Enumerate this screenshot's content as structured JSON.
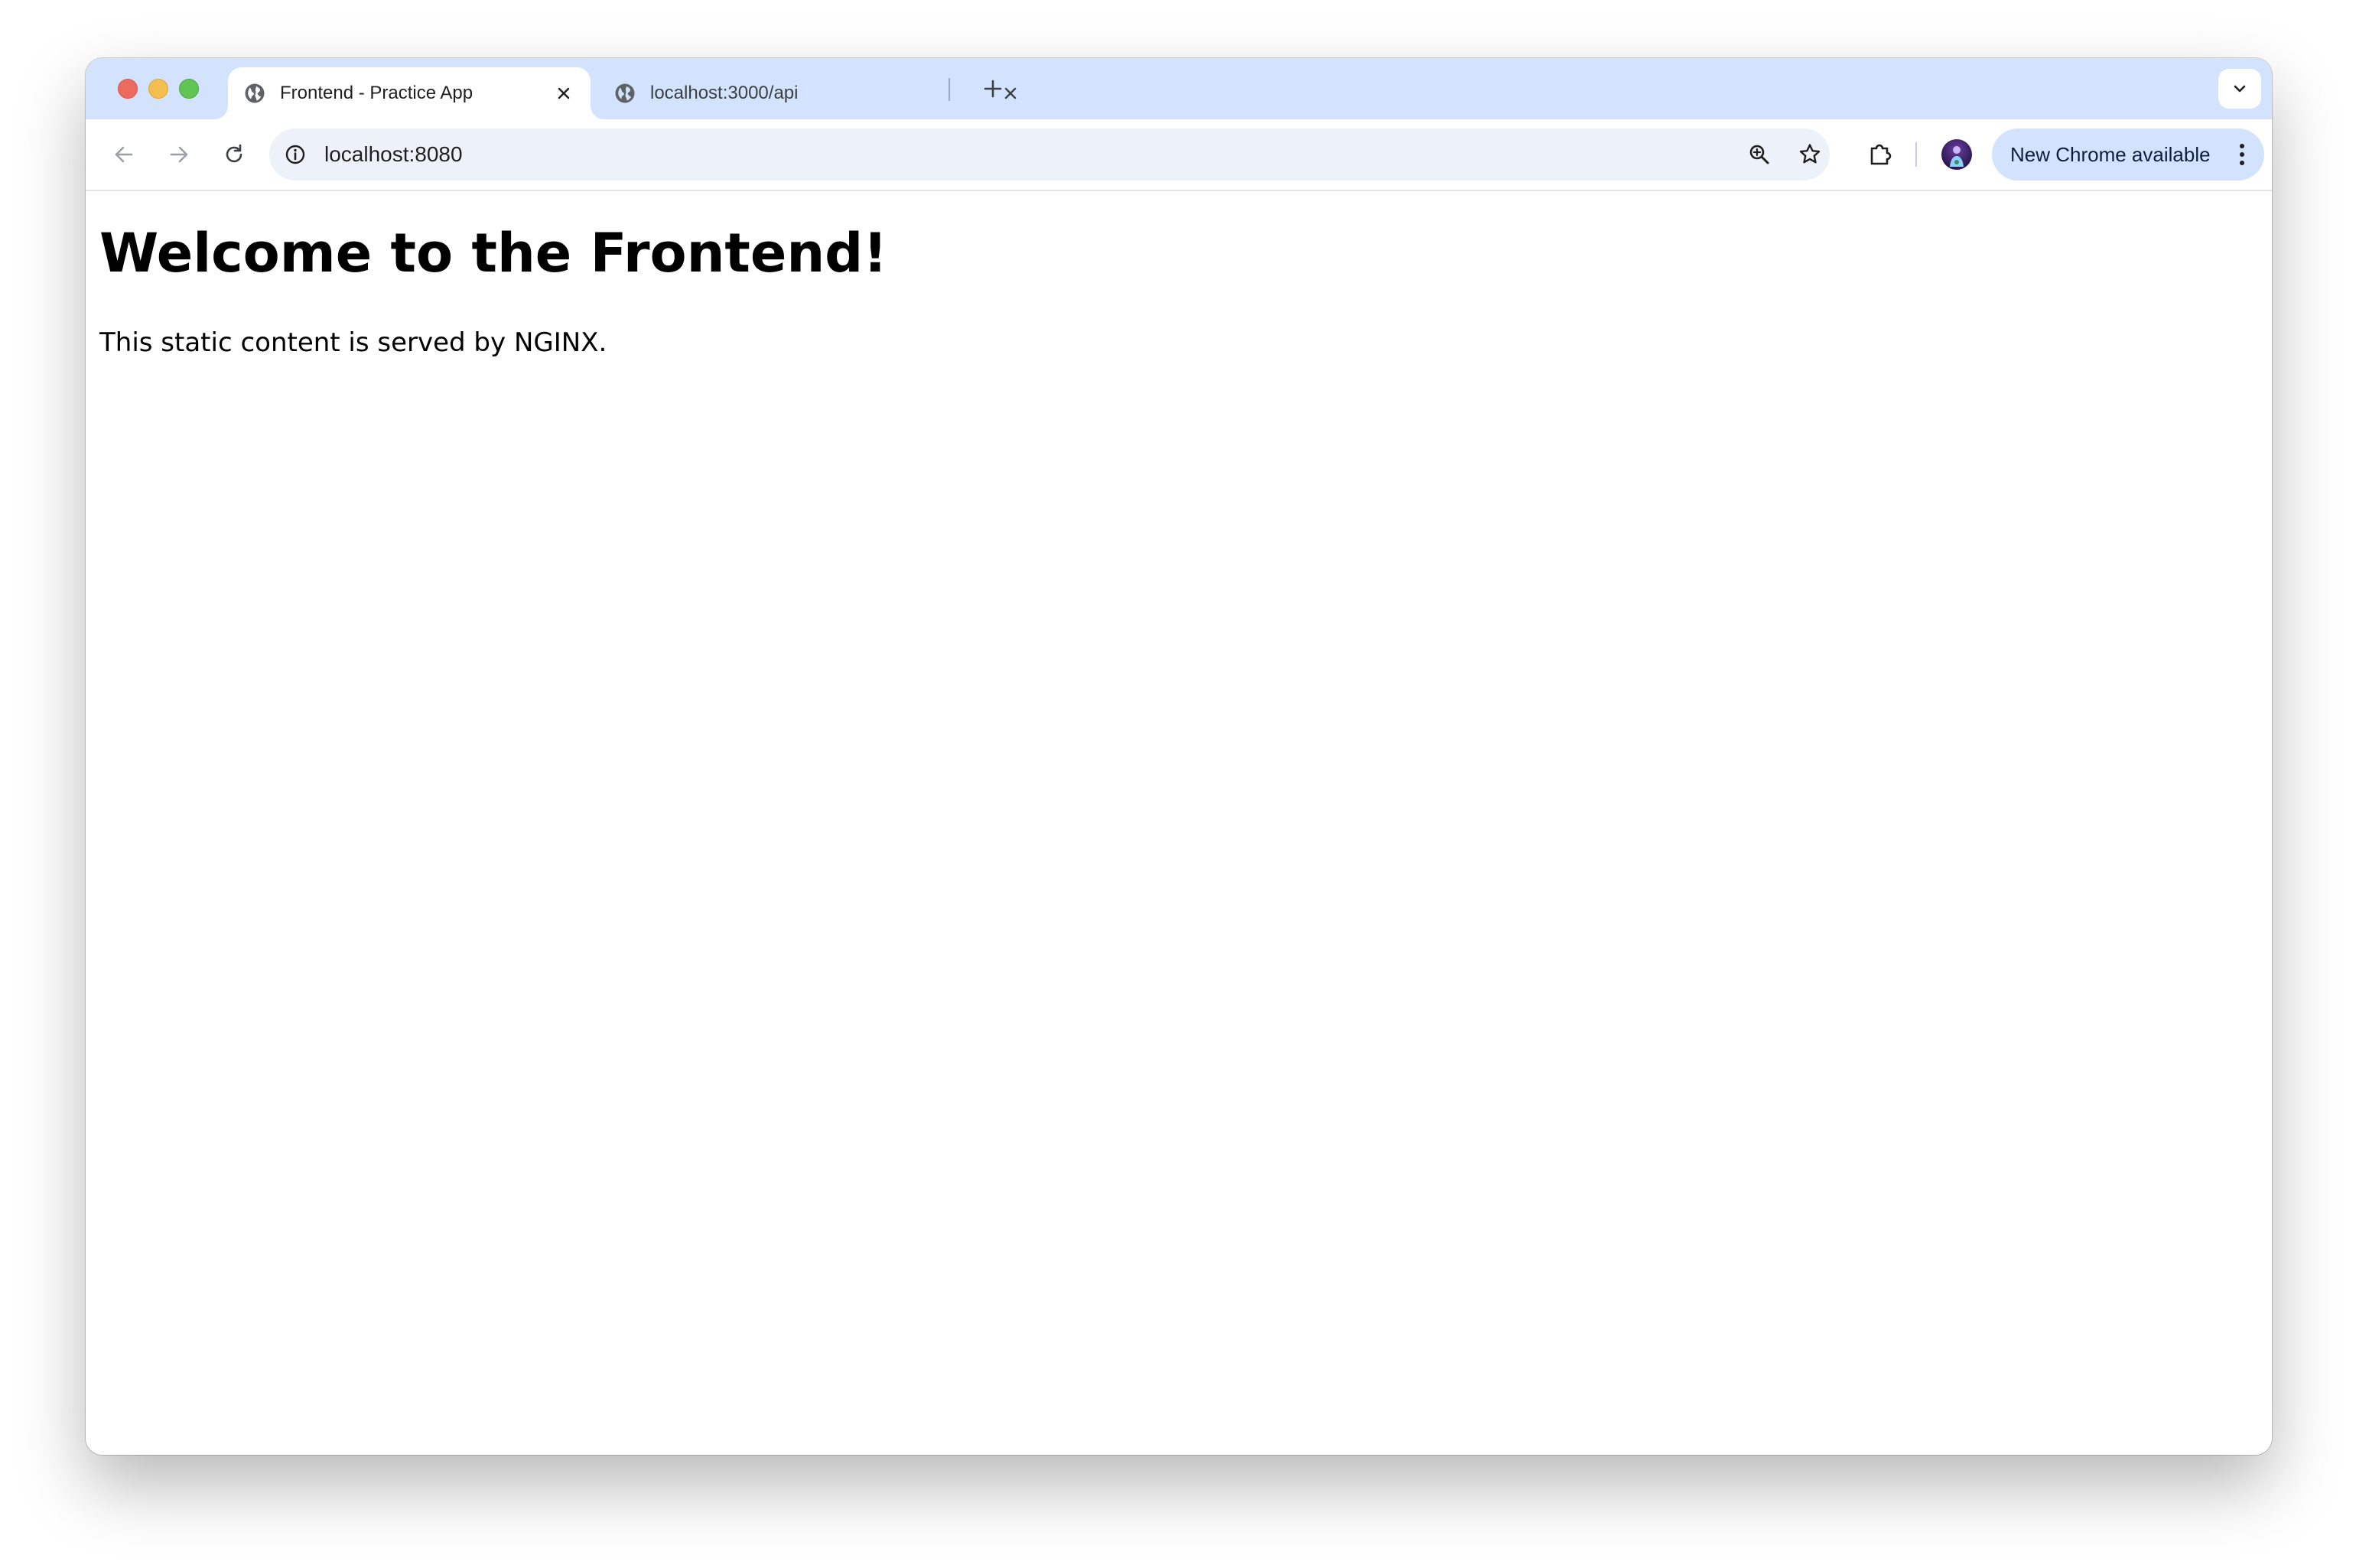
{
  "tabs": [
    {
      "title": "Frontend - Practice App",
      "favicon": "globe-icon",
      "active": true
    },
    {
      "title": "localhost:3000/api",
      "favicon": "globe-icon",
      "active": false
    }
  ],
  "toolbar": {
    "url": "localhost:8080",
    "update_label": "New Chrome available"
  },
  "page": {
    "heading": "Welcome to the Frontend!",
    "paragraph": "This static content is served by NGINX."
  },
  "colors": {
    "tabstrip": "#d3e3fd",
    "omnibox": "#edf2fa",
    "update_pill": "#d3e3fd"
  }
}
